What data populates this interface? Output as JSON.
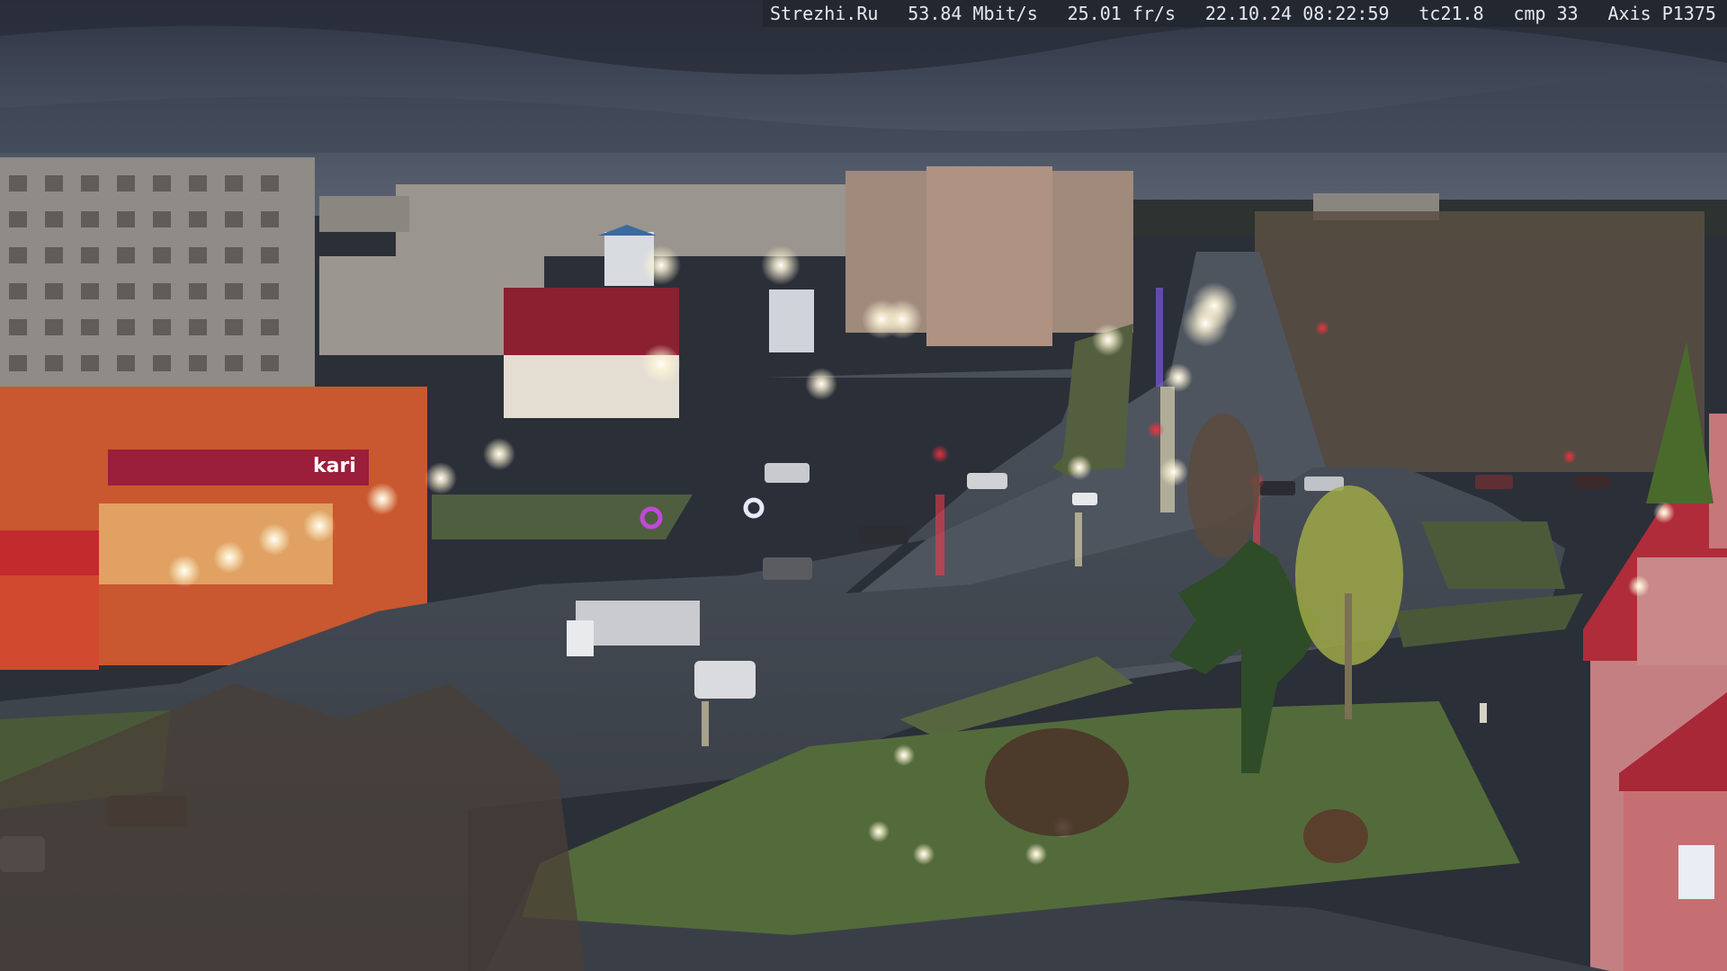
{
  "overlay": {
    "site": "Strezhi.Ru",
    "bitrate": "53.84 Mbit/s",
    "framerate": "25.01 fr/s",
    "datetime": "22.10.24 08:22:59",
    "tc": "tc21.8",
    "cmp": "cmp 33",
    "camera": "Axis P1375"
  },
  "signs": {
    "store_logo": "kari"
  },
  "colors": {
    "sky": "#3a4252",
    "road": "#3c4148",
    "grass": "#4b5a3a",
    "building_orange": "#c8552e",
    "building_grey": "#8c8a86",
    "roof_red": "#9a2230"
  }
}
